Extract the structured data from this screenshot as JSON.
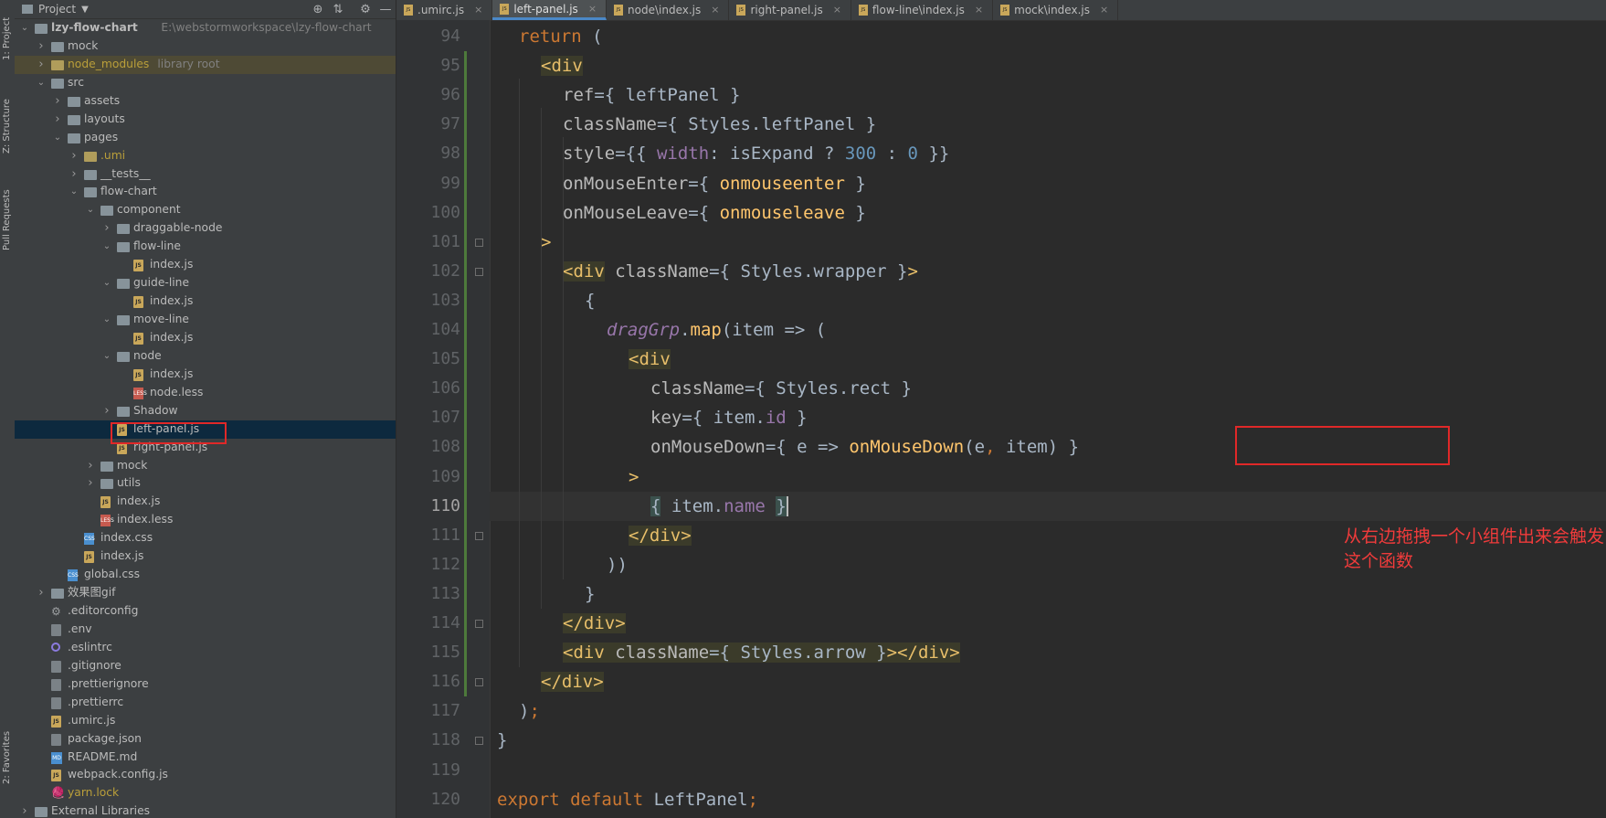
{
  "side_tabs": [
    "1: Project",
    "Z: Structure",
    "Pull Requests",
    "2: Favorites"
  ],
  "project_panel": {
    "title": "Project",
    "tree": [
      {
        "label": "lzy-flow-chart",
        "path": "E:\\webstormworkspace\\lzy-flow-chart",
        "depth": 0,
        "type": "folder",
        "expanded": true,
        "bold": true
      },
      {
        "label": "mock",
        "depth": 1,
        "type": "folder",
        "expanded": false
      },
      {
        "label": "node_modules",
        "suffix": "library root",
        "depth": 1,
        "type": "folder-orange",
        "expanded": false,
        "library": true
      },
      {
        "label": "src",
        "depth": 1,
        "type": "folder",
        "expanded": true
      },
      {
        "label": "assets",
        "depth": 2,
        "type": "folder",
        "expanded": false
      },
      {
        "label": "layouts",
        "depth": 2,
        "type": "folder",
        "expanded": false
      },
      {
        "label": "pages",
        "depth": 2,
        "type": "folder",
        "expanded": true
      },
      {
        "label": ".umi",
        "depth": 3,
        "type": "folder-orange",
        "expanded": false,
        "gold": true
      },
      {
        "label": "__tests__",
        "depth": 3,
        "type": "folder",
        "expanded": false
      },
      {
        "label": "flow-chart",
        "depth": 3,
        "type": "folder",
        "expanded": true
      },
      {
        "label": "component",
        "depth": 4,
        "type": "folder",
        "expanded": true
      },
      {
        "label": "draggable-node",
        "depth": 5,
        "type": "folder",
        "expanded": false
      },
      {
        "label": "flow-line",
        "depth": 5,
        "type": "folder",
        "expanded": true
      },
      {
        "label": "index.js",
        "depth": 6,
        "type": "js"
      },
      {
        "label": "guide-line",
        "depth": 5,
        "type": "folder",
        "expanded": true
      },
      {
        "label": "index.js",
        "depth": 6,
        "type": "js"
      },
      {
        "label": "move-line",
        "depth": 5,
        "type": "folder",
        "expanded": true
      },
      {
        "label": "index.js",
        "depth": 6,
        "type": "js"
      },
      {
        "label": "node",
        "depth": 5,
        "type": "folder",
        "expanded": true
      },
      {
        "label": "index.js",
        "depth": 6,
        "type": "js"
      },
      {
        "label": "node.less",
        "depth": 6,
        "type": "less"
      },
      {
        "label": "Shadow",
        "depth": 5,
        "type": "folder",
        "expanded": false
      },
      {
        "label": "left-panel.js",
        "depth": 5,
        "type": "js",
        "selected": true
      },
      {
        "label": "right-panel.js",
        "depth": 5,
        "type": "js"
      },
      {
        "label": "mock",
        "depth": 4,
        "type": "folder",
        "expanded": false
      },
      {
        "label": "utils",
        "depth": 4,
        "type": "folder",
        "expanded": false
      },
      {
        "label": "index.js",
        "depth": 4,
        "type": "js"
      },
      {
        "label": "index.less",
        "depth": 4,
        "type": "less"
      },
      {
        "label": "index.css",
        "depth": 3,
        "type": "css"
      },
      {
        "label": "index.js",
        "depth": 3,
        "type": "js"
      },
      {
        "label": "global.css",
        "depth": 2,
        "type": "css"
      },
      {
        "label": "效果图gif",
        "depth": 1,
        "type": "folder",
        "expanded": false
      },
      {
        "label": ".editorconfig",
        "depth": 1,
        "type": "gear"
      },
      {
        "label": ".env",
        "depth": 1,
        "type": "cfg"
      },
      {
        "label": ".eslintrc",
        "depth": 1,
        "type": "eslint"
      },
      {
        "label": ".gitignore",
        "depth": 1,
        "type": "cfg"
      },
      {
        "label": ".prettierignore",
        "depth": 1,
        "type": "cfg"
      },
      {
        "label": ".prettierrc",
        "depth": 1,
        "type": "cfg"
      },
      {
        "label": ".umirc.js",
        "depth": 1,
        "type": "js"
      },
      {
        "label": "package.json",
        "depth": 1,
        "type": "cfg"
      },
      {
        "label": "README.md",
        "depth": 1,
        "type": "md"
      },
      {
        "label": "webpack.config.js",
        "depth": 1,
        "type": "js"
      },
      {
        "label": "yarn.lock",
        "depth": 1,
        "type": "yarn",
        "gold": true
      },
      {
        "label": "External Libraries",
        "depth": 0,
        "type": "folder",
        "expanded": false
      }
    ]
  },
  "tabs": [
    {
      "label": ".umirc.js",
      "active": false
    },
    {
      "label": "left-panel.js",
      "active": true
    },
    {
      "label": "node\\index.js",
      "active": false
    },
    {
      "label": "right-panel.js",
      "active": false
    },
    {
      "label": "flow-line\\index.js",
      "active": false
    },
    {
      "label": "mock\\index.js",
      "active": false
    }
  ],
  "editor": {
    "current_line": 110,
    "lines": [
      {
        "n": 94,
        "indent": 1,
        "tokens": [
          [
            "kw",
            "return"
          ],
          [
            "plain",
            " ("
          ]
        ]
      },
      {
        "n": 95,
        "indent": 2,
        "tokens": [
          [
            "tag tagbg",
            "<div"
          ]
        ]
      },
      {
        "n": 96,
        "indent": 3,
        "tokens": [
          [
            "attr",
            "ref"
          ],
          [
            "plain",
            "={ leftPanel }"
          ]
        ]
      },
      {
        "n": 97,
        "indent": 3,
        "tokens": [
          [
            "attr",
            "className"
          ],
          [
            "plain",
            "={ Styles.leftPanel }"
          ]
        ]
      },
      {
        "n": 98,
        "indent": 3,
        "tokens": [
          [
            "attr",
            "style"
          ],
          [
            "plain",
            "={{ "
          ],
          [
            "prop",
            "width"
          ],
          [
            "plain",
            ": isExpand ? "
          ],
          [
            "num",
            "300"
          ],
          [
            "plain",
            " : "
          ],
          [
            "num",
            "0"
          ],
          [
            "plain",
            " }}"
          ]
        ]
      },
      {
        "n": 99,
        "indent": 3,
        "tokens": [
          [
            "attr",
            "onMouseEnter"
          ],
          [
            "plain",
            "={ "
          ],
          [
            "fn",
            "onmouseenter"
          ],
          [
            "plain",
            " }"
          ]
        ]
      },
      {
        "n": 100,
        "indent": 3,
        "tokens": [
          [
            "attr",
            "onMouseLeave"
          ],
          [
            "plain",
            "={ "
          ],
          [
            "fn",
            "onmouseleave"
          ],
          [
            "plain",
            " }"
          ]
        ]
      },
      {
        "n": 101,
        "indent": 2,
        "tokens": [
          [
            "tag",
            ">"
          ]
        ]
      },
      {
        "n": 102,
        "indent": 3,
        "tokens": [
          [
            "tag tagbg",
            "<div"
          ],
          [
            "attr",
            " className"
          ],
          [
            "plain",
            "={ Styles.wrapper }"
          ],
          [
            "tag",
            ">"
          ]
        ]
      },
      {
        "n": 103,
        "indent": 4,
        "tokens": [
          [
            "plain",
            "{"
          ]
        ]
      },
      {
        "n": 104,
        "indent": 5,
        "tokens": [
          [
            "prop italic",
            "dragGrp"
          ],
          [
            "plain",
            "."
          ],
          [
            "fn",
            "map"
          ],
          [
            "plain",
            "(item => ("
          ]
        ]
      },
      {
        "n": 105,
        "indent": 6,
        "tokens": [
          [
            "tag tagbg",
            "<div"
          ]
        ]
      },
      {
        "n": 106,
        "indent": 7,
        "tokens": [
          [
            "attr",
            "className"
          ],
          [
            "plain",
            "={ Styles.rect }"
          ]
        ]
      },
      {
        "n": 107,
        "indent": 7,
        "tokens": [
          [
            "attr",
            "key"
          ],
          [
            "plain",
            "={ item."
          ],
          [
            "prop",
            "id"
          ],
          [
            "plain",
            " }"
          ]
        ]
      },
      {
        "n": 108,
        "indent": 7,
        "tokens": [
          [
            "attr",
            "onMouseDown"
          ],
          [
            "plain",
            "={ e => "
          ],
          [
            "fn",
            "onMouseDown"
          ],
          [
            "plain",
            "(e"
          ],
          [
            "kw",
            ","
          ],
          [
            "plain",
            " item) }"
          ]
        ]
      },
      {
        "n": 109,
        "indent": 6,
        "tokens": [
          [
            "tag",
            ">"
          ]
        ]
      },
      {
        "n": 110,
        "indent": 7,
        "tokens": [
          [
            "plain bracehl",
            "{"
          ],
          [
            "plain",
            " item."
          ],
          [
            "prop",
            "name"
          ],
          [
            "plain",
            " "
          ],
          [
            "plain bracehl",
            "}"
          ]
        ]
      },
      {
        "n": 111,
        "indent": 6,
        "tokens": [
          [
            "tag tagbg",
            "</div>"
          ]
        ]
      },
      {
        "n": 112,
        "indent": 5,
        "tokens": [
          [
            "plain",
            "))"
          ]
        ]
      },
      {
        "n": 113,
        "indent": 4,
        "tokens": [
          [
            "plain",
            "}"
          ]
        ]
      },
      {
        "n": 114,
        "indent": 3,
        "tokens": [
          [
            "tag tagbg",
            "</div>"
          ]
        ]
      },
      {
        "n": 115,
        "indent": 3,
        "tokens": [
          [
            "tag tagbg",
            "<div"
          ],
          [
            "attr tagbg",
            " className"
          ],
          [
            "plain tagbg",
            "={ Styles.arrow }"
          ],
          [
            "tag tagbg",
            "></div>"
          ]
        ]
      },
      {
        "n": 116,
        "indent": 2,
        "tokens": [
          [
            "tag tagbg",
            "</div>"
          ]
        ]
      },
      {
        "n": 117,
        "indent": 1,
        "tokens": [
          [
            "plain",
            ")"
          ],
          [
            "kw",
            ";"
          ]
        ]
      },
      {
        "n": 118,
        "indent": 0,
        "tokens": [
          [
            "plain",
            "}"
          ]
        ]
      },
      {
        "n": 119,
        "indent": 0,
        "tokens": []
      },
      {
        "n": 120,
        "indent": 0,
        "tokens": [
          [
            "kw",
            "export default "
          ],
          [
            "plain",
            "LeftPanel"
          ],
          [
            "kw",
            ";"
          ]
        ]
      }
    ],
    "annotation": "从右边拖拽一个小组件出来会触发这个函数"
  }
}
